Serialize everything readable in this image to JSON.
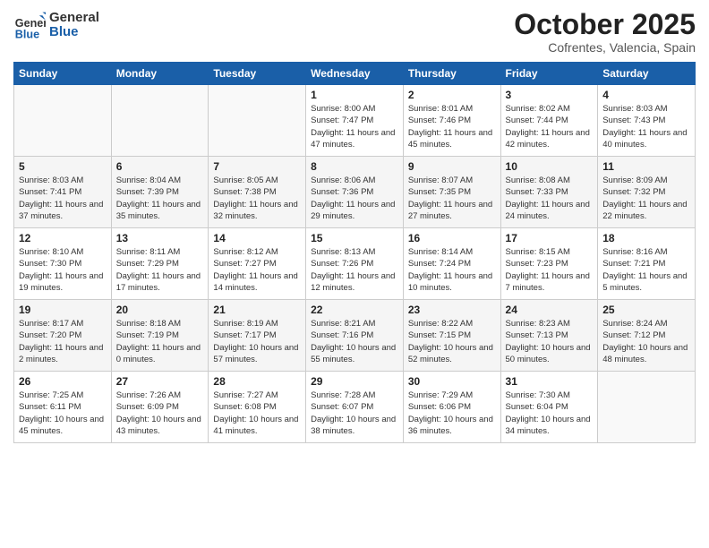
{
  "header": {
    "logo_general": "General",
    "logo_blue": "Blue",
    "month_title": "October 2025",
    "subtitle": "Cofrentes, Valencia, Spain"
  },
  "days_of_week": [
    "Sunday",
    "Monday",
    "Tuesday",
    "Wednesday",
    "Thursday",
    "Friday",
    "Saturday"
  ],
  "weeks": [
    [
      {
        "day": "",
        "info": ""
      },
      {
        "day": "",
        "info": ""
      },
      {
        "day": "",
        "info": ""
      },
      {
        "day": "1",
        "info": "Sunrise: 8:00 AM\nSunset: 7:47 PM\nDaylight: 11 hours\nand 47 minutes."
      },
      {
        "day": "2",
        "info": "Sunrise: 8:01 AM\nSunset: 7:46 PM\nDaylight: 11 hours\nand 45 minutes."
      },
      {
        "day": "3",
        "info": "Sunrise: 8:02 AM\nSunset: 7:44 PM\nDaylight: 11 hours\nand 42 minutes."
      },
      {
        "day": "4",
        "info": "Sunrise: 8:03 AM\nSunset: 7:43 PM\nDaylight: 11 hours\nand 40 minutes."
      }
    ],
    [
      {
        "day": "5",
        "info": "Sunrise: 8:03 AM\nSunset: 7:41 PM\nDaylight: 11 hours\nand 37 minutes."
      },
      {
        "day": "6",
        "info": "Sunrise: 8:04 AM\nSunset: 7:39 PM\nDaylight: 11 hours\nand 35 minutes."
      },
      {
        "day": "7",
        "info": "Sunrise: 8:05 AM\nSunset: 7:38 PM\nDaylight: 11 hours\nand 32 minutes."
      },
      {
        "day": "8",
        "info": "Sunrise: 8:06 AM\nSunset: 7:36 PM\nDaylight: 11 hours\nand 29 minutes."
      },
      {
        "day": "9",
        "info": "Sunrise: 8:07 AM\nSunset: 7:35 PM\nDaylight: 11 hours\nand 27 minutes."
      },
      {
        "day": "10",
        "info": "Sunrise: 8:08 AM\nSunset: 7:33 PM\nDaylight: 11 hours\nand 24 minutes."
      },
      {
        "day": "11",
        "info": "Sunrise: 8:09 AM\nSunset: 7:32 PM\nDaylight: 11 hours\nand 22 minutes."
      }
    ],
    [
      {
        "day": "12",
        "info": "Sunrise: 8:10 AM\nSunset: 7:30 PM\nDaylight: 11 hours\nand 19 minutes."
      },
      {
        "day": "13",
        "info": "Sunrise: 8:11 AM\nSunset: 7:29 PM\nDaylight: 11 hours\nand 17 minutes."
      },
      {
        "day": "14",
        "info": "Sunrise: 8:12 AM\nSunset: 7:27 PM\nDaylight: 11 hours\nand 14 minutes."
      },
      {
        "day": "15",
        "info": "Sunrise: 8:13 AM\nSunset: 7:26 PM\nDaylight: 11 hours\nand 12 minutes."
      },
      {
        "day": "16",
        "info": "Sunrise: 8:14 AM\nSunset: 7:24 PM\nDaylight: 11 hours\nand 10 minutes."
      },
      {
        "day": "17",
        "info": "Sunrise: 8:15 AM\nSunset: 7:23 PM\nDaylight: 11 hours\nand 7 minutes."
      },
      {
        "day": "18",
        "info": "Sunrise: 8:16 AM\nSunset: 7:21 PM\nDaylight: 11 hours\nand 5 minutes."
      }
    ],
    [
      {
        "day": "19",
        "info": "Sunrise: 8:17 AM\nSunset: 7:20 PM\nDaylight: 11 hours\nand 2 minutes."
      },
      {
        "day": "20",
        "info": "Sunrise: 8:18 AM\nSunset: 7:19 PM\nDaylight: 11 hours\nand 0 minutes."
      },
      {
        "day": "21",
        "info": "Sunrise: 8:19 AM\nSunset: 7:17 PM\nDaylight: 10 hours\nand 57 minutes."
      },
      {
        "day": "22",
        "info": "Sunrise: 8:21 AM\nSunset: 7:16 PM\nDaylight: 10 hours\nand 55 minutes."
      },
      {
        "day": "23",
        "info": "Sunrise: 8:22 AM\nSunset: 7:15 PM\nDaylight: 10 hours\nand 52 minutes."
      },
      {
        "day": "24",
        "info": "Sunrise: 8:23 AM\nSunset: 7:13 PM\nDaylight: 10 hours\nand 50 minutes."
      },
      {
        "day": "25",
        "info": "Sunrise: 8:24 AM\nSunset: 7:12 PM\nDaylight: 10 hours\nand 48 minutes."
      }
    ],
    [
      {
        "day": "26",
        "info": "Sunrise: 7:25 AM\nSunset: 6:11 PM\nDaylight: 10 hours\nand 45 minutes."
      },
      {
        "day": "27",
        "info": "Sunrise: 7:26 AM\nSunset: 6:09 PM\nDaylight: 10 hours\nand 43 minutes."
      },
      {
        "day": "28",
        "info": "Sunrise: 7:27 AM\nSunset: 6:08 PM\nDaylight: 10 hours\nand 41 minutes."
      },
      {
        "day": "29",
        "info": "Sunrise: 7:28 AM\nSunset: 6:07 PM\nDaylight: 10 hours\nand 38 minutes."
      },
      {
        "day": "30",
        "info": "Sunrise: 7:29 AM\nSunset: 6:06 PM\nDaylight: 10 hours\nand 36 minutes."
      },
      {
        "day": "31",
        "info": "Sunrise: 7:30 AM\nSunset: 6:04 PM\nDaylight: 10 hours\nand 34 minutes."
      },
      {
        "day": "",
        "info": ""
      }
    ]
  ]
}
